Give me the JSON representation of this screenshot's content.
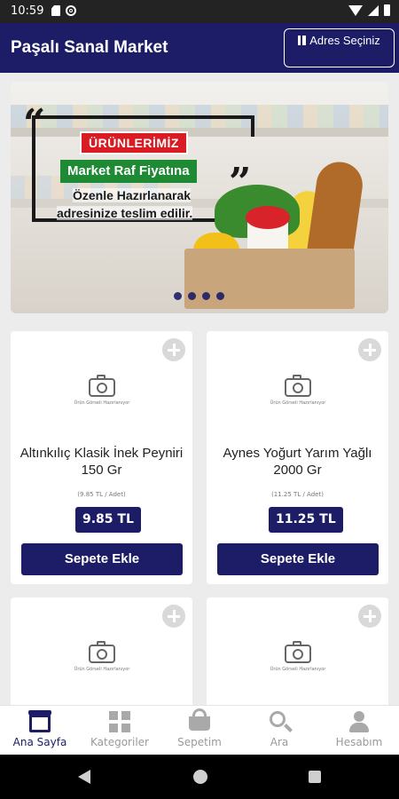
{
  "status_bar": {
    "time": "10:59"
  },
  "header": {
    "title": "Paşalı Sanal Market",
    "address_button": "Adres Seçiniz"
  },
  "banner": {
    "tag1": "ÜRÜNLERİMİZ",
    "tag2": "Market Raf Fiyatına",
    "line1": "Özenle Hazırlanarak",
    "line2": "adresinize teslim edilir.",
    "dots": 4
  },
  "products": [
    {
      "name": "Altınkılıç Klasik İnek Peyniri 150 Gr",
      "unit_price": "(9.85 TL / Adet)",
      "price": "9.85 TL",
      "button": "Sepete Ekle",
      "no_image_text": "Ürün Görseli Hazırlanıyor"
    },
    {
      "name": "Aynes Yoğurt Yarım Yağlı 2000 Gr",
      "unit_price": "(11.25 TL / Adet)",
      "price": "11.25 TL",
      "button": "Sepete Ekle",
      "no_image_text": "Ürün Görseli Hazırlanıyor"
    },
    {
      "no_image_text": "Ürün Görseli Hazırlanıyor"
    },
    {
      "no_image_text": "Ürün Görseli Hazırlanıyor"
    }
  ],
  "bottom_nav": [
    {
      "label": "Ana Sayfa",
      "icon": "store-icon",
      "active": true
    },
    {
      "label": "Kategoriler",
      "icon": "grid-icon",
      "active": false
    },
    {
      "label": "Sepetim",
      "icon": "basket-icon",
      "active": false
    },
    {
      "label": "Ara",
      "icon": "search-icon",
      "active": false
    },
    {
      "label": "Hesabım",
      "icon": "user-icon",
      "active": false
    }
  ],
  "colors": {
    "primary": "#1d1d67",
    "background": "#ececec",
    "inactive": "#9a9a9a"
  }
}
